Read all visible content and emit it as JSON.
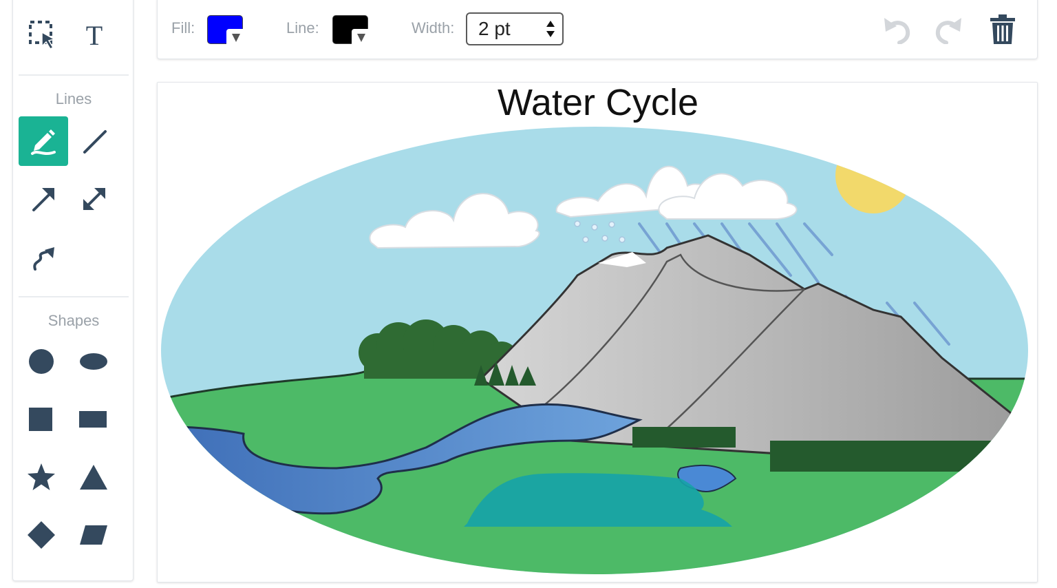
{
  "toolbox": {
    "tools": [
      {
        "name": "select-tool",
        "icon": "marquee-select-icon"
      },
      {
        "name": "text-tool",
        "icon": "text-t-icon",
        "glyph": "T"
      }
    ],
    "lines_label": "Lines",
    "line_tools": [
      {
        "name": "freehand-pen-tool",
        "icon": "pen-icon",
        "active": true
      },
      {
        "name": "line-tool",
        "icon": "line-icon"
      },
      {
        "name": "arrow-tool",
        "icon": "arrow-icon"
      },
      {
        "name": "double-arrow-tool",
        "icon": "double-arrow-icon"
      },
      {
        "name": "curved-arrow-tool",
        "icon": "curved-arrow-icon"
      }
    ],
    "shapes_label": "Shapes",
    "shape_tools": [
      {
        "name": "circle-tool",
        "icon": "circle-icon"
      },
      {
        "name": "ellipse-tool",
        "icon": "ellipse-icon"
      },
      {
        "name": "square-tool",
        "icon": "square-icon"
      },
      {
        "name": "rectangle-tool",
        "icon": "rectangle-icon"
      },
      {
        "name": "star-tool",
        "icon": "star-icon"
      },
      {
        "name": "triangle-tool",
        "icon": "triangle-icon"
      },
      {
        "name": "diamond-tool",
        "icon": "diamond-icon"
      },
      {
        "name": "parallelogram-tool",
        "icon": "parallelogram-icon"
      }
    ],
    "active_color": "#1ab394",
    "icon_color": "#34495e"
  },
  "toolbar": {
    "fill_label": "Fill:",
    "fill_color": "#0000ff",
    "line_label": "Line:",
    "line_color": "#000000",
    "width_label": "Width:",
    "width_value": "2 pt",
    "undo_icon": "undo-icon",
    "redo_icon": "redo-icon",
    "delete_icon": "trash-icon"
  },
  "canvas": {
    "title": "Water Cycle",
    "illustration": "water-cycle-diagram"
  }
}
